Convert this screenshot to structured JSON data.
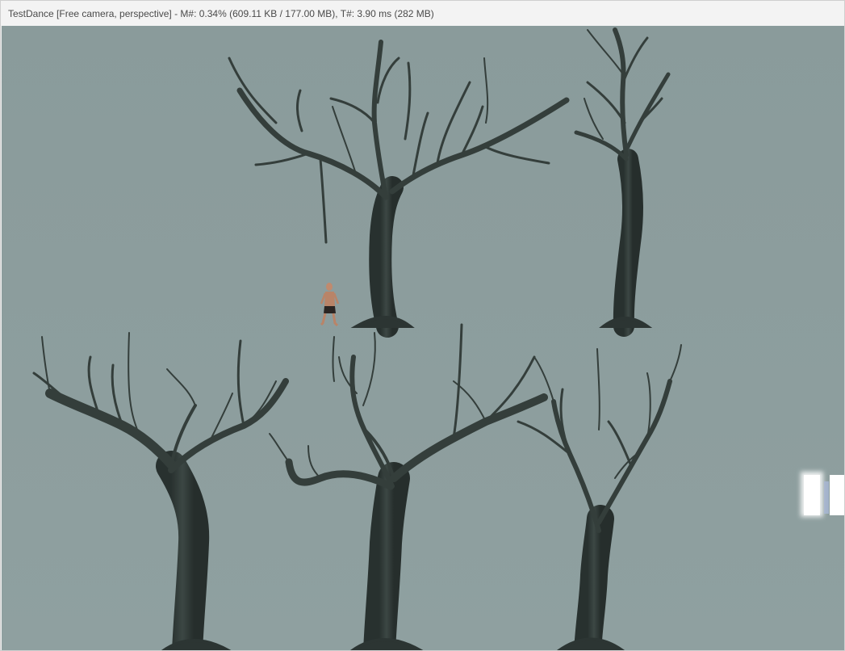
{
  "window": {
    "title": "TestDance [Free camera, perspective] - M#: 0.34% (609.11 KB / 177.00 MB), T#: 3.90 ms (282 MB)"
  },
  "scene": {
    "background_color": "#8d9e9e",
    "trunk_color": "#2f3a37",
    "branch_color": "#39433f",
    "character_skin_color": "#c08a6e",
    "character_shorts_color": "#2b2522",
    "light_color": "#ffffff"
  }
}
